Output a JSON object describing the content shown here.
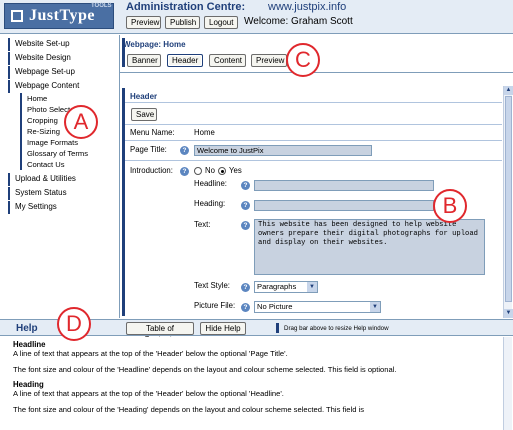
{
  "header": {
    "logo_text": "JustType",
    "logo_super": "TOOLS",
    "admin_title": "Administration Centre:",
    "site": "www.justpix.info",
    "buttons": [
      "Preview",
      "Publish",
      "Logout"
    ],
    "welcome": "Welcome: Graham Scott"
  },
  "sidebar": {
    "items": [
      {
        "label": "Website Set-up"
      },
      {
        "label": "Website Design"
      },
      {
        "label": "Webpage Set-up"
      },
      {
        "label": "Webpage Content"
      }
    ],
    "subitems": [
      {
        "label": "Home"
      },
      {
        "label": "Photo Selector"
      },
      {
        "label": "Cropping"
      },
      {
        "label": "Re-Sizing"
      },
      {
        "label": "Image Formats"
      },
      {
        "label": "Glossary of Terms"
      },
      {
        "label": "Contact Us"
      }
    ],
    "bottom_items": [
      {
        "label": "Upload & Utilities"
      },
      {
        "label": "System Status"
      },
      {
        "label": "My Settings"
      }
    ]
  },
  "main": {
    "breadcrumb": "Webpage: Home",
    "tabs": [
      "Banner",
      "Header",
      "Content",
      "Preview"
    ],
    "active_tab": "Header",
    "panel_title": "Header",
    "save_label": "Save",
    "fields": {
      "menu_name_label": "Menu Name:",
      "menu_name_value": "Home",
      "page_title_label": "Page Title:",
      "page_title_value": "Welcome to JustPix",
      "introduction_label": "Introduction:",
      "radio_no": "No",
      "radio_yes": "Yes",
      "introduction_selected": "Yes",
      "headline_label": "Headline:",
      "headline_value": "",
      "heading_label": "Heading:",
      "heading_value": "",
      "text_label": "Text:",
      "text_value": "This website has been designed to help website owners prepare their digital photographs for upload and display on their websites.",
      "text_style_label": "Text Style:",
      "text_style_value": "Paragraphs",
      "picture_file_label": "Picture File:",
      "picture_file_value": "No Picture"
    }
  },
  "help": {
    "title": "Help",
    "buttons": [
      "Table of Contents",
      "Hide Help"
    ],
    "drag_hint": "Drag bar above to resize Help window",
    "sections": [
      {
        "heading": "Headline",
        "para1": "A line of text that appears at the top of the 'Header' below the optional 'Page Title'.",
        "para2": "The font size and colour of the 'Headline' depends on the layout and colour scheme selected. This field is optional."
      },
      {
        "heading": "Heading",
        "para1": "A line of text that appears at the top of the 'Header' below the optional 'Headline'.",
        "para2": "The font size and colour of the 'Heading' depends on the layout and colour scheme selected. This field is"
      }
    ]
  },
  "callouts": [
    "A",
    "B",
    "C",
    "D"
  ],
  "colors": {
    "accent": "#1f3f7a",
    "callout": "#e0282d",
    "field_bg": "#c8d2e0",
    "bar_bg": "#e4ecf5"
  },
  "icons": {
    "field_help": "question-mark-icon",
    "logo": "square-icon",
    "drag": "drag-bar-icon"
  }
}
